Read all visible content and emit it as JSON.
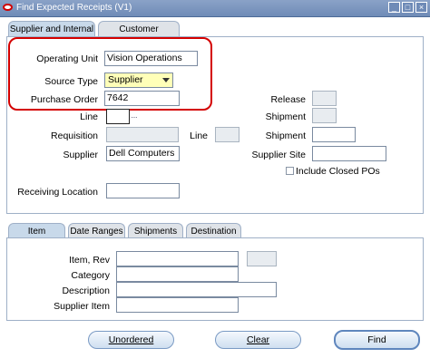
{
  "window": {
    "title": "Find Expected Receipts (V1)"
  },
  "top_tabs": [
    {
      "label": "Supplier and Internal"
    },
    {
      "label": "Customer"
    }
  ],
  "fields": {
    "operating_unit": {
      "label": "Operating Unit",
      "value": "Vision Operations"
    },
    "source_type": {
      "label": "Source Type",
      "value": "Supplier"
    },
    "purchase_order": {
      "label": "Purchase Order",
      "value": "7642"
    },
    "release": {
      "label": "Release",
      "value": ""
    },
    "line": {
      "label": "Line",
      "value": ""
    },
    "shipment_top": {
      "label": "Shipment",
      "value": ""
    },
    "requisition": {
      "label": "Requisition",
      "value": ""
    },
    "req_line": {
      "label": "Line",
      "value": ""
    },
    "shipment_req": {
      "label": "Shipment",
      "value": ""
    },
    "supplier": {
      "label": "Supplier",
      "value": "Dell Computers"
    },
    "supplier_site": {
      "label": "Supplier Site",
      "value": ""
    },
    "include_closed_pos": {
      "label": "Include Closed POs",
      "checked": false
    },
    "receiving_location": {
      "label": "Receiving Location",
      "value": ""
    }
  },
  "bottom_tabs": [
    {
      "label": "Item"
    },
    {
      "label": "Date Ranges"
    },
    {
      "label": "Shipments"
    },
    {
      "label": "Destination"
    }
  ],
  "item_fields": {
    "item_rev": {
      "label": "Item, Rev",
      "value": ""
    },
    "category": {
      "label": "Category",
      "value": ""
    },
    "description": {
      "label": "Description",
      "value": ""
    },
    "supplier_item": {
      "label": "Supplier Item",
      "value": ""
    }
  },
  "buttons": {
    "unordered": "Unordered",
    "clear": "Clear",
    "find": "Find"
  },
  "lov_glyph": "...",
  "window_buttons": [
    "_",
    "□",
    "×"
  ],
  "colors": {
    "highlight": "#d40000",
    "required_field": "#ffffb8",
    "title_bar": "#6f8bb7"
  }
}
